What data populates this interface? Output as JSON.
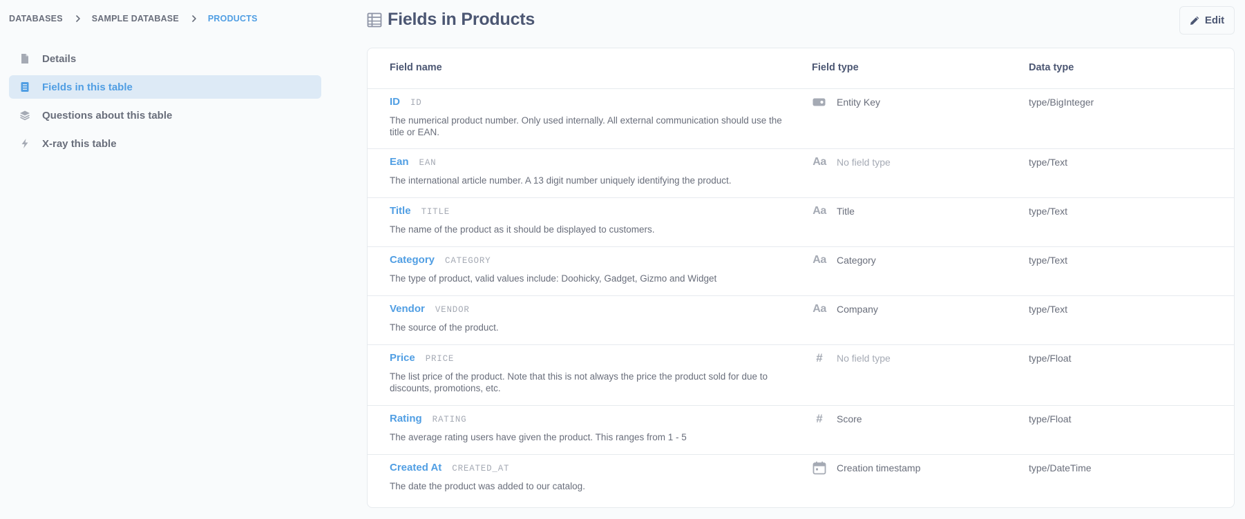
{
  "breadcrumb": {
    "items": [
      "Databases",
      "Sample Database",
      "Products"
    ]
  },
  "sidebar": {
    "items": [
      {
        "label": "Details",
        "icon": "document-icon",
        "active": false
      },
      {
        "label": "Fields in this table",
        "icon": "list-icon",
        "active": true
      },
      {
        "label": "Questions about this table",
        "icon": "layers-icon",
        "active": false
      },
      {
        "label": "X-ray this table",
        "icon": "bolt-icon",
        "active": false
      }
    ]
  },
  "header": {
    "title": "Fields in Products",
    "edit_label": "Edit"
  },
  "table": {
    "columns": {
      "field_name": "Field name",
      "field_type": "Field type",
      "data_type": "Data type"
    },
    "rows": [
      {
        "display_name": "ID",
        "db_name": "ID",
        "description": "The numerical product number. Only used internally. All external communication should use the title or EAN.",
        "field_type": "Entity Key",
        "field_type_icon": "key-icon",
        "field_type_muted": false,
        "data_type": "type/BigInteger"
      },
      {
        "display_name": "Ean",
        "db_name": "EAN",
        "description": "The international article number. A 13 digit number uniquely identifying the product.",
        "field_type": "No field type",
        "field_type_icon": "text-icon",
        "field_type_muted": true,
        "data_type": "type/Text"
      },
      {
        "display_name": "Title",
        "db_name": "TITLE",
        "description": "The name of the product as it should be displayed to customers.",
        "field_type": "Title",
        "field_type_icon": "text-icon",
        "field_type_muted": false,
        "data_type": "type/Text"
      },
      {
        "display_name": "Category",
        "db_name": "CATEGORY",
        "description": "The type of product, valid values include: Doohicky, Gadget, Gizmo and Widget",
        "field_type": "Category",
        "field_type_icon": "text-icon",
        "field_type_muted": false,
        "data_type": "type/Text"
      },
      {
        "display_name": "Vendor",
        "db_name": "VENDOR",
        "description": "The source of the product.",
        "field_type": "Company",
        "field_type_icon": "text-icon",
        "field_type_muted": false,
        "data_type": "type/Text"
      },
      {
        "display_name": "Price",
        "db_name": "PRICE",
        "description": "The list price of the product. Note that this is not always the price the product sold for due to discounts, promotions, etc.",
        "field_type": "No field type",
        "field_type_icon": "number-icon",
        "field_type_muted": true,
        "data_type": "type/Float"
      },
      {
        "display_name": "Rating",
        "db_name": "RATING",
        "description": "The average rating users have given the product. This ranges from 1 - 5",
        "field_type": "Score",
        "field_type_icon": "number-icon",
        "field_type_muted": false,
        "data_type": "type/Float"
      },
      {
        "display_name": "Created At",
        "db_name": "CREATED_AT",
        "description": "The date the product was added to our catalog.",
        "field_type": "Creation timestamp",
        "field_type_icon": "calendar-icon",
        "field_type_muted": false,
        "data_type": "type/DateTime"
      }
    ]
  },
  "colors": {
    "brand": "#509ee3",
    "text_dark": "#4c5773",
    "text_medium": "#696e7b",
    "text_light": "#a5aab4",
    "border": "#e6eaee",
    "active_bg": "#ddeaf6"
  }
}
